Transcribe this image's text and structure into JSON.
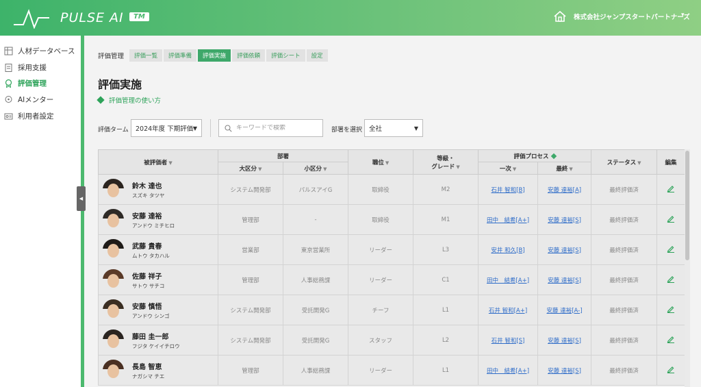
{
  "app": {
    "logo_text": "PULSE AI",
    "tm": "TM",
    "company": "株式会社ジャンプスタートパートナーズ"
  },
  "sidebar": {
    "items": [
      {
        "label": "人材データベース",
        "icon": "database-icon"
      },
      {
        "label": "採用支援",
        "icon": "clipboard-icon"
      },
      {
        "label": "評価管理",
        "icon": "badge-icon"
      },
      {
        "label": "AIメンター",
        "icon": "mentor-icon"
      },
      {
        "label": "利用者設定",
        "icon": "user-settings-icon"
      }
    ]
  },
  "breadcrumb": {
    "label": "評価管理",
    "tabs": [
      "評価一覧",
      "評価準備",
      "評価実施",
      "評価依頼",
      "評価シート",
      "設定"
    ]
  },
  "page": {
    "title": "評価実施",
    "howto": "評価管理の使い方"
  },
  "filters": {
    "term_label": "評価ターム",
    "term_value": "2024年度 下期評価",
    "search_placeholder": "キーワードで検索",
    "dept_label": "部署を選択",
    "dept_value": "全社"
  },
  "table": {
    "headers": {
      "evaluatee": "被評価者",
      "dept": "部署",
      "dept_major": "大区分",
      "dept_minor": "小区分",
      "position": "職位",
      "grade": "等級・\nグレード",
      "process": "評価プロセス",
      "first": "一次",
      "final": "最終",
      "status": "ステータス",
      "edit": "編集"
    },
    "rows": [
      {
        "name": "鈴木 達也",
        "kana": "スズキ タツヤ",
        "major": "システム開発部",
        "minor": "パルスアイG",
        "position": "取締役",
        "grade": "M2",
        "first": "石井 智和[B]",
        "final": "安藤 達裕[A]",
        "status": "最終評価済",
        "hair": "#2b241f"
      },
      {
        "name": "安藤 達裕",
        "kana": "アンドウ ミチヒロ",
        "major": "管理部",
        "minor": "-",
        "position": "取締役",
        "grade": "M1",
        "first": "田中　結希[A+]",
        "final": "安藤 達裕[S]",
        "status": "最終評価済",
        "hair": "#2e2a26"
      },
      {
        "name": "武藤 貴春",
        "kana": "ムトウ タカハル",
        "major": "営業部",
        "minor": "東京営業所",
        "position": "リーダー",
        "grade": "L3",
        "first": "安井 和久[B]",
        "final": "安藤 達裕[S]",
        "status": "最終評価済",
        "hair": "#1f1b18"
      },
      {
        "name": "佐藤 祥子",
        "kana": "サトウ サチコ",
        "major": "管理部",
        "minor": "人事総務課",
        "position": "リーダー",
        "grade": "C1",
        "first": "田中　結希[A+]",
        "final": "安藤 達裕[S]",
        "status": "最終評価済",
        "hair": "#5a3a28"
      },
      {
        "name": "安藤 慎悟",
        "kana": "アンドウ シンゴ",
        "major": "システム開発部",
        "minor": "受託開発G",
        "position": "チーフ",
        "grade": "L1",
        "first": "石井 智和[A+]",
        "final": "安藤 達裕[A-]",
        "status": "最終評価済",
        "hair": "#3a2d22"
      },
      {
        "name": "藤田 圭一郎",
        "kana": "フジタ ケイイチロウ",
        "major": "システム開発部",
        "minor": "受託開発G",
        "position": "スタッフ",
        "grade": "L2",
        "first": "石井 智和[S]",
        "final": "安藤 達裕[S]",
        "status": "最終評価済",
        "hair": "#2a2420"
      },
      {
        "name": "長島 智恵",
        "kana": "ナガシマ チエ",
        "major": "管理部",
        "minor": "人事総務課",
        "position": "リーダー",
        "grade": "L1",
        "first": "田中　結希[A+]",
        "final": "安藤 達裕[S]",
        "status": "最終評価済",
        "hair": "#4a3022"
      }
    ]
  },
  "colors": {
    "brand": "#3ea86a",
    "link": "#2f6dc9"
  }
}
